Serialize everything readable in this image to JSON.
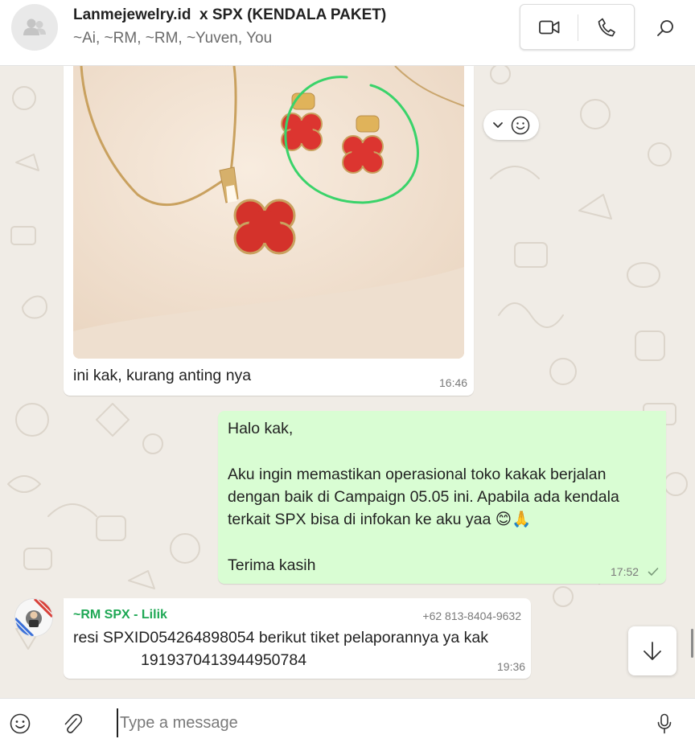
{
  "header": {
    "title": "Lanmejewelry.id  x SPX (KENDALA PAKET)",
    "members": "~Ai, ~RM, ~RM, ~Yuven, You",
    "video_call_icon": "video-camera-icon",
    "voice_call_icon": "phone-icon",
    "search_icon": "search-icon"
  },
  "messages": [
    {
      "direction": "incoming",
      "type": "image",
      "caption": "ini kak, kurang anting nya",
      "time": "16:46"
    },
    {
      "direction": "outgoing",
      "lines": [
        "Halo kak,",
        "",
        "Aku ingin memastikan operasional toko kakak berjalan",
        "dengan baik di Campaign 05.05 ini. Apabila ada kendala",
        "terkait SPX bisa di infokan ke aku yaa 😊🙏",
        "",
        "Terima kasih"
      ],
      "time": "17:52",
      "status": "sent"
    },
    {
      "direction": "incoming",
      "sender": "~RM SPX - Lilik",
      "phone": "+62 813-8404-9632",
      "line1": "resi SPXID054264898054 berikut tiket pelaporannya ya kak",
      "line2": "1919370413944950784",
      "time": "19:36"
    }
  ],
  "composer": {
    "placeholder": "Type a message",
    "emoji_icon": "emoji-icon",
    "attach_icon": "paperclip-icon",
    "mic_icon": "microphone-icon"
  },
  "colors": {
    "outgoing_bubble": "#d9fdd3",
    "incoming_bubble": "#ffffff",
    "sender_name": "#1fa855",
    "chat_background": "#f0ece6"
  }
}
